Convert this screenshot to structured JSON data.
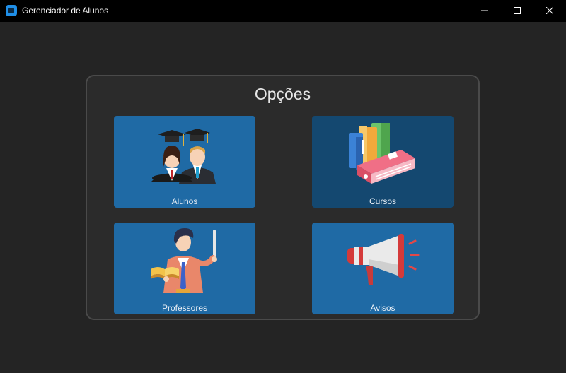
{
  "window": {
    "title": "Gerenciador de Alunos",
    "icons": {
      "app": "app-icon",
      "minimize": "minimize-icon",
      "maximize": "maximize-icon",
      "close": "close-icon"
    }
  },
  "panel": {
    "title": "Opções"
  },
  "tiles": [
    {
      "label": "Alunos",
      "icon": "graduates-icon"
    },
    {
      "label": "Cursos",
      "icon": "books-icon",
      "state": "hover"
    },
    {
      "label": "Professores",
      "icon": "teacher-icon"
    },
    {
      "label": "Avisos",
      "icon": "megaphone-icon"
    }
  ],
  "colors": {
    "window_bg": "#242424",
    "titlebar_bg": "#000000",
    "panel_bg": "#2b2b2b",
    "panel_border": "#4a4a4a",
    "tile_bg": "#1f6aa5",
    "tile_hover_bg": "#144870"
  }
}
